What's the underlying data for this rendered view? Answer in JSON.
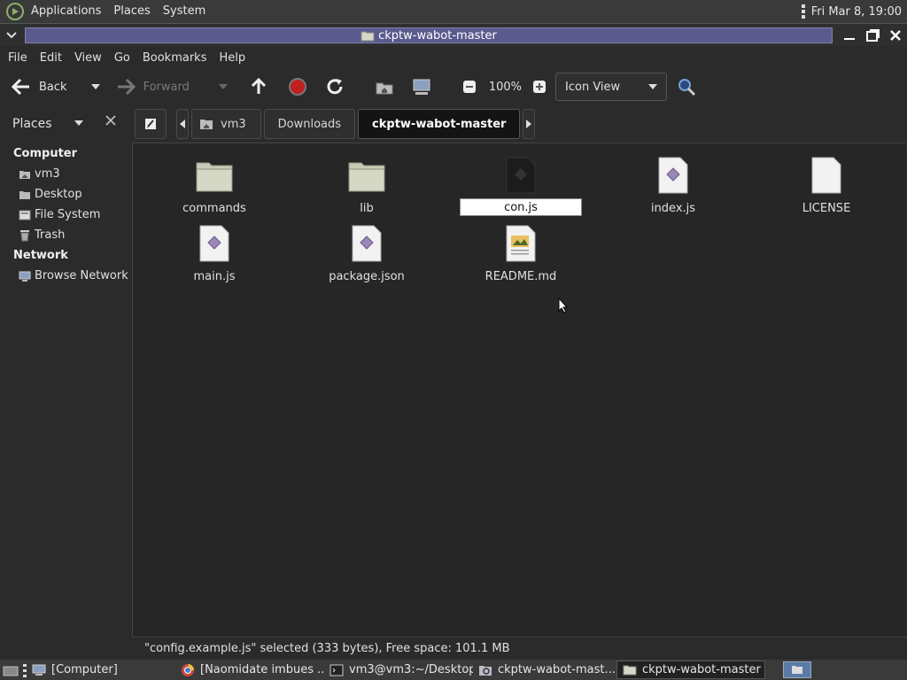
{
  "top_panel": {
    "menus": [
      "Applications",
      "Places",
      "System"
    ],
    "clock": "Fri Mar  8, 19:00"
  },
  "window": {
    "title": "ckptw-wabot-master"
  },
  "menubar": [
    "File",
    "Edit",
    "View",
    "Go",
    "Bookmarks",
    "Help"
  ],
  "toolbar": {
    "back_label": "Back",
    "forward_label": "Forward",
    "zoom": "100%",
    "view_mode": "Icon View"
  },
  "sidebar": {
    "header": "Places",
    "sections": [
      {
        "title": "Computer",
        "items": [
          "vm3",
          "Desktop",
          "File System",
          "Trash"
        ]
      },
      {
        "title": "Network",
        "items": [
          "Browse Network"
        ]
      }
    ]
  },
  "pathbar": {
    "crumbs": [
      "vm3",
      "Downloads",
      "ckptw-wabot-master"
    ]
  },
  "files": [
    {
      "name": "commands",
      "type": "folder"
    },
    {
      "name": "lib",
      "type": "folder"
    },
    {
      "name": "con.js",
      "type": "renaming"
    },
    {
      "name": "index.js",
      "type": "script"
    },
    {
      "name": "LICENSE",
      "type": "text"
    },
    {
      "name": "main.js",
      "type": "script"
    },
    {
      "name": "package.json",
      "type": "script"
    },
    {
      "name": "README.md",
      "type": "markdown"
    }
  ],
  "status": "\"config.example.js\" selected (333 bytes), Free space: 101.1 MB",
  "taskbar": {
    "show_desktop": "[Computer]",
    "tasks": [
      "[Naomidate imbues ...",
      "vm3@vm3:~/Desktop",
      "ckptw-wabot-mast...",
      "ckptw-wabot-master"
    ]
  }
}
